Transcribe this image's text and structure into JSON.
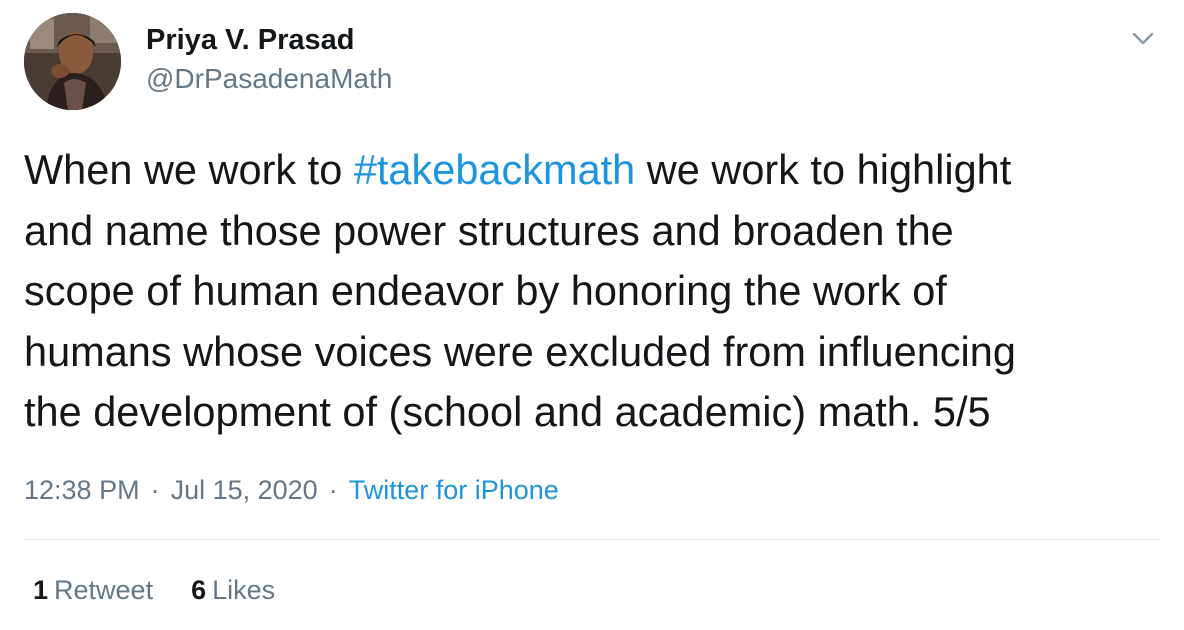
{
  "tweet": {
    "author": {
      "display_name": "Priya V. Prasad",
      "handle": "@DrPasadenaMath"
    },
    "text_lines": [
      {
        "before": "When we work to ",
        "hashtag": "#takebackmath",
        "after": " we work to highlight"
      },
      {
        "before": "and name those power structures and broaden the"
      },
      {
        "before": "scope of human endeavor by honoring the work of"
      },
      {
        "before": "humans whose voices were excluded from influencing"
      },
      {
        "before": "the development of (school and academic) math. 5/5"
      }
    ],
    "time": "12:38 PM",
    "separator": "·",
    "date": "Jul 15, 2020",
    "source": "Twitter for iPhone",
    "stats": {
      "retweets_count": "1",
      "retweets_label": "Retweet",
      "likes_count": "6",
      "likes_label": "Likes"
    }
  },
  "icons": {
    "menu": "chevron-down-icon",
    "avatar": "profile-photo"
  },
  "colors": {
    "text": "#14171a",
    "secondary_text": "#657786",
    "link": "#1b95e0",
    "divider": "#e6ecf0"
  }
}
